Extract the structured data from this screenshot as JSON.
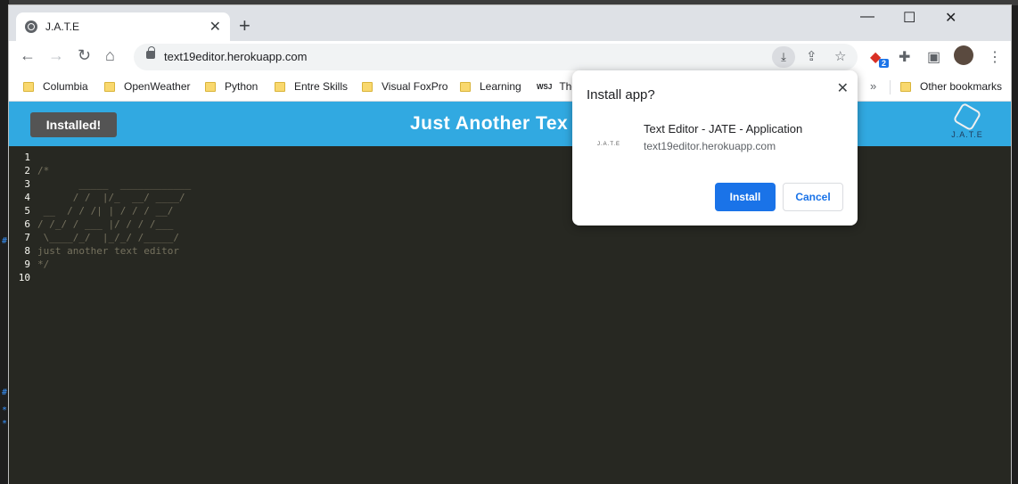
{
  "browser": {
    "tab_title": "J.A.T.E",
    "tab_close": "✕",
    "new_tab": "+",
    "minimize": "—",
    "maximize": "☐",
    "close": "✕",
    "url": "text19editor.herokuapp.com",
    "extension_badge": "2"
  },
  "bookmarks": [
    "Columbia",
    "OpenWeather",
    "Python",
    "Entre Skills",
    "Visual FoxPro",
    "Learning",
    "The",
    "Other bookmarks"
  ],
  "bookmark_wsj_label": "WSJ",
  "bookmark_more": "»",
  "app": {
    "installed_button": "Installed!",
    "title": "Just Another Tex",
    "logo_text": "J.A.T.E"
  },
  "editor": {
    "lines": [
      {
        "n": "1",
        "code": ""
      },
      {
        "n": "2",
        "code": "/*"
      },
      {
        "n": "3",
        "code": "       _____  ____________"
      },
      {
        "n": "4",
        "code": "      / /  |/_  __/ ____/"
      },
      {
        "n": "5",
        "code": " __  / / /| | / / / __/"
      },
      {
        "n": "6",
        "code": "/ /_/ / ___ |/ / / /___"
      },
      {
        "n": "7",
        "code": " \\____/_/  |_/_/ /_____/"
      },
      {
        "n": "8",
        "code": "just another text editor"
      },
      {
        "n": "9",
        "code": "*/"
      },
      {
        "n": "10",
        "code": ""
      }
    ]
  },
  "dialog": {
    "title": "Install app?",
    "app_icon_text": "J.A.T.E",
    "app_name": "Text Editor - JATE - Application",
    "origin": "text19editor.herokuapp.com",
    "install": "Install",
    "cancel": "Cancel"
  }
}
